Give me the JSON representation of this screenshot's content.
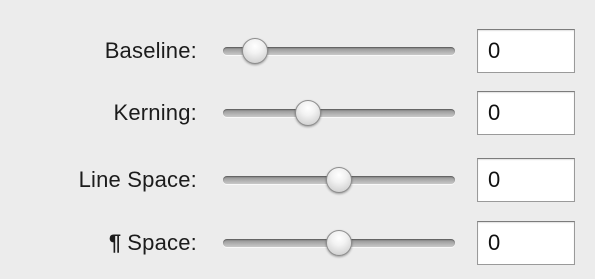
{
  "rows": [
    {
      "label": "Baseline:",
      "value": "0",
      "slider_fraction": 0.09
    },
    {
      "label": "Kerning:",
      "value": "0",
      "slider_fraction": 0.35
    },
    {
      "label": "Line Space:",
      "value": "0",
      "slider_fraction": 0.5
    },
    {
      "label": "Space:",
      "prefix_glyph": "¶",
      "value": "0",
      "slider_fraction": 0.5
    }
  ]
}
